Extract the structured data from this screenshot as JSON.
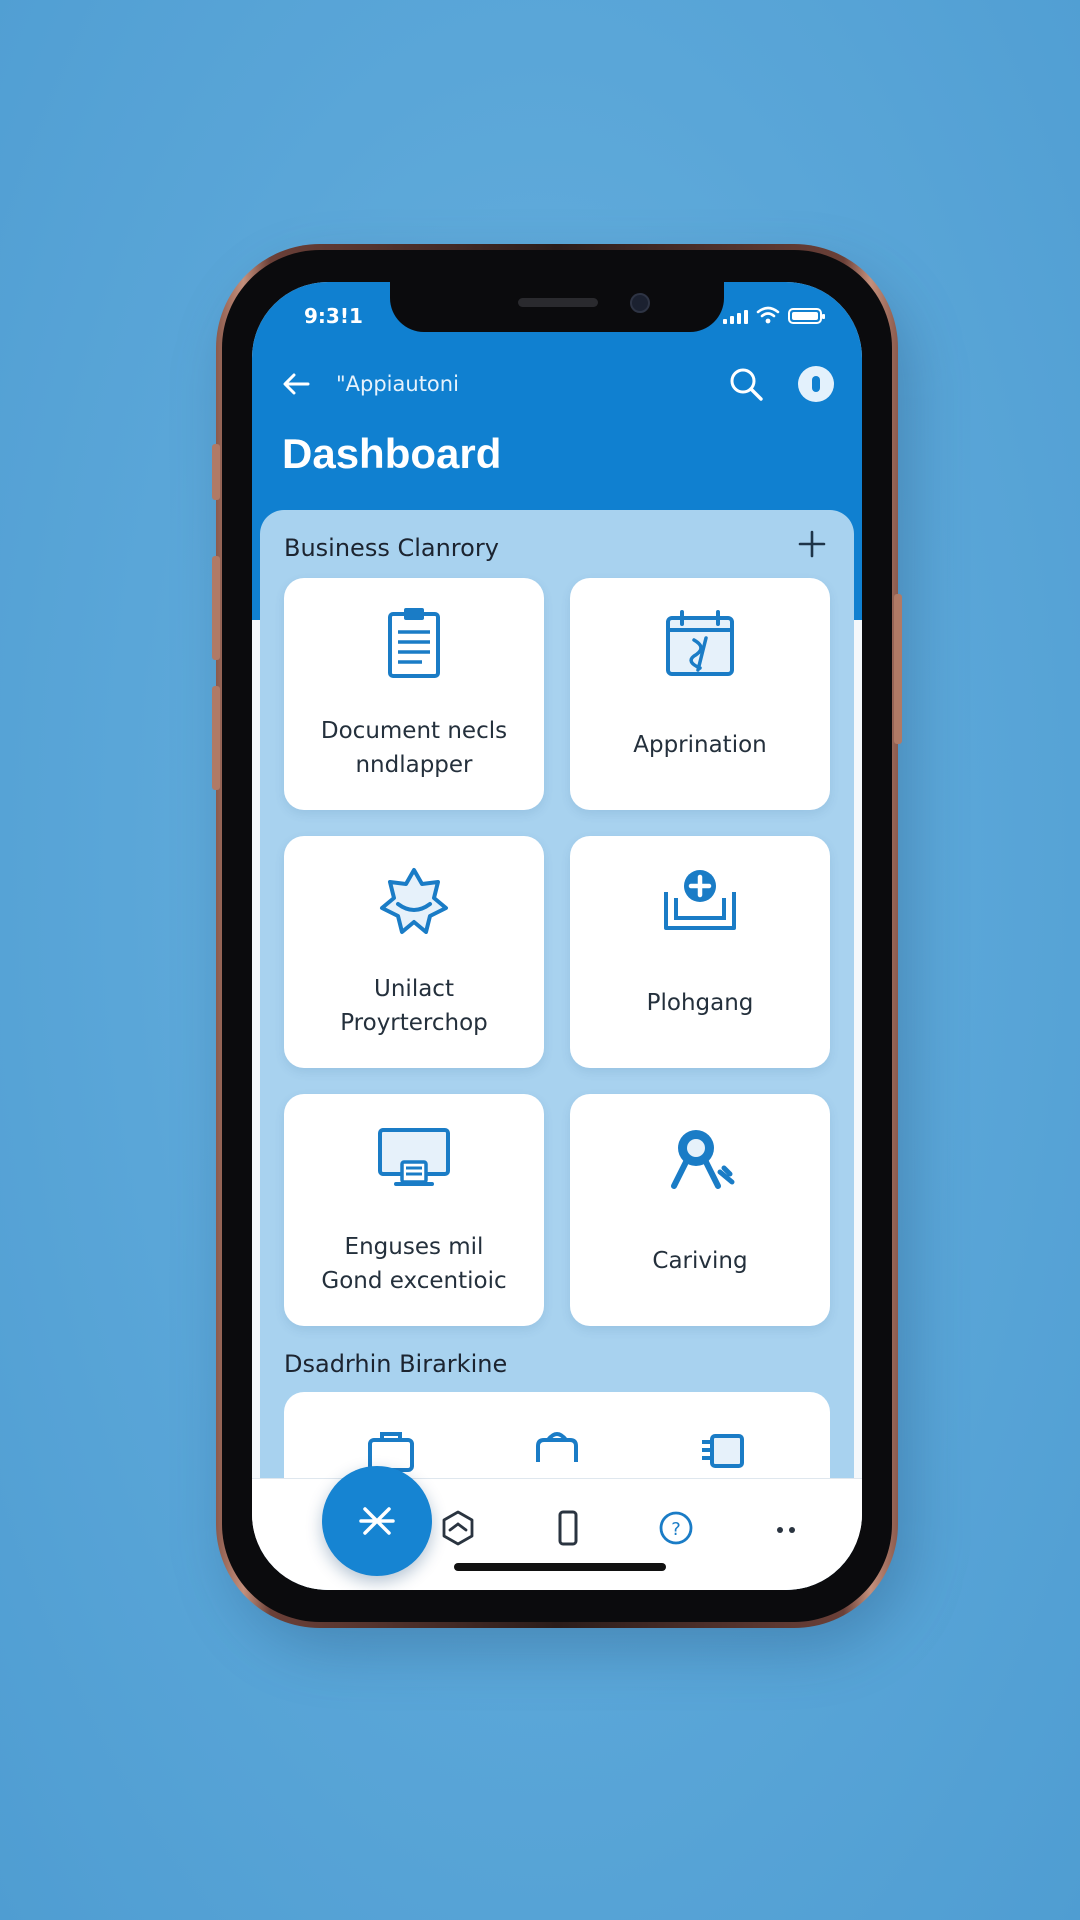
{
  "status_bar": {
    "time": "9:3!1"
  },
  "app_bar": {
    "title": "\"Appiautoni"
  },
  "page": {
    "title": "Dashboard"
  },
  "section": {
    "title": "Business Clanrory",
    "tiles": [
      {
        "line1": "Document necls",
        "line2": "nndlapper",
        "icon": "clipboard-icon"
      },
      {
        "line1": "Apprination",
        "line2": "",
        "icon": "calendar-icon"
      },
      {
        "line1": "Unilact",
        "line2": "Proyrterchop",
        "icon": "handshake-icon"
      },
      {
        "line1": "Plohgang",
        "line2": "",
        "icon": "medical-case-icon"
      },
      {
        "line1": "Enguses mil",
        "line2": "Gond excentioic",
        "icon": "monitor-icon"
      },
      {
        "line1": "Cariving",
        "line2": "",
        "icon": "award-badge-icon"
      }
    ]
  },
  "section2": {
    "title": "Dsadrhin Birarkine"
  },
  "bottom_nav": {
    "items": [
      "fab-icon",
      "cube-icon",
      "phone-icon",
      "help-icon",
      "more-icon"
    ]
  },
  "colors": {
    "primary": "#1080D0",
    "panel": "#A8D2EF",
    "background": "#5BA8D9"
  }
}
